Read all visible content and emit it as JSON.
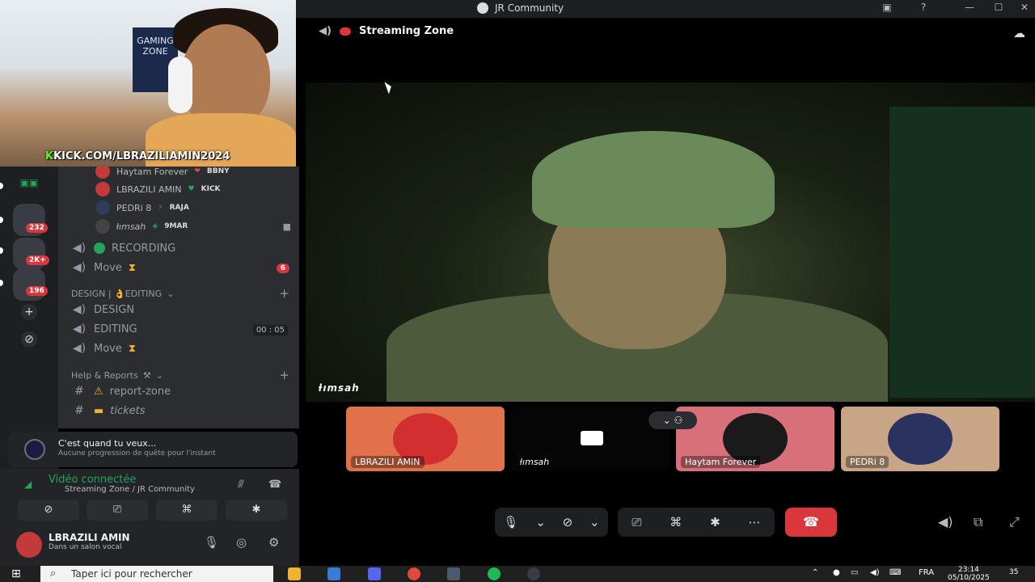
{
  "window": {
    "title": "JR Community",
    "minimize": "—",
    "maximize": "☐",
    "close": "✕",
    "help": "?"
  },
  "webcam": {
    "poster": "GAMING ZONE",
    "overlay_prefix": "K",
    "overlay_text": "KICK.COM/LBRAZILIAMIN2024"
  },
  "rail": {
    "badges": [
      "232",
      "2K+",
      "196"
    ],
    "add": "+",
    "discover": "⊘"
  },
  "channels": {
    "members": [
      {
        "name": "Haytam Forever",
        "tag": "BBNY",
        "tag_icon": "❤"
      },
      {
        "name": "LBRAZILI AMIN",
        "tag": "KICK",
        "tag_icon": "♥"
      },
      {
        "name": "PEDRi 8",
        "tag": "RAJA",
        "tag_icon": "⚡"
      },
      {
        "name": "ƚımsah",
        "tag": "9MAR",
        "tag_icon": "◈"
      }
    ],
    "recording": "RECORDING",
    "move1": "Move",
    "move1_badge": "6",
    "cat_design": "DESIGN | 👌EDITING",
    "design": "DESIGN",
    "editing": "EDITING",
    "editing_timer": "00 : 05",
    "move2": "Move",
    "cat_help": "Help & Reports",
    "report_zone": "report-zone",
    "tickets": "tickets"
  },
  "quest": {
    "title": "C'est quand tu veux...",
    "subtitle": "Aucune progression de quête pour l'instant"
  },
  "voice": {
    "status": "Vidéo connectée",
    "location": "Streaming Zone / JR Community"
  },
  "user": {
    "name": "LBRAZILI AMIN",
    "status": "Dans un salon vocal"
  },
  "stage": {
    "channel": "Streaming Zone",
    "main_name": "ƚımsah",
    "tiles": [
      {
        "name": "LBRAZILI AMIN"
      },
      {
        "name": "ƚımsah"
      },
      {
        "name": "Haytam Forever"
      },
      {
        "name": "PEDRi 8"
      }
    ]
  },
  "taskbar": {
    "search_placeholder": "Taper ici pour rechercher",
    "lang": "FRA",
    "time": "23:14",
    "date": "05/10/2025",
    "notif": "35"
  },
  "colors": {
    "accent": "#5865f2",
    "danger": "#da373c",
    "online": "#23a55a"
  }
}
